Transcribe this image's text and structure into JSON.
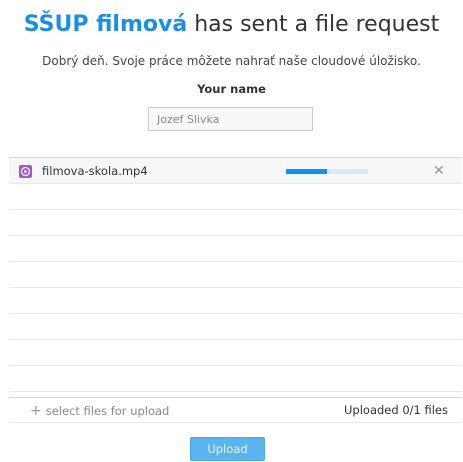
{
  "header": {
    "sender": "SŠUP filmová",
    "rest": "has sent a file request"
  },
  "message": "Dobrý deň. Svoje práce môžete nahrať naše cloudové úložisko.",
  "name_field": {
    "label": "Your name",
    "value": "Jozef Slivka"
  },
  "files": [
    {
      "name": "filmova-skola.mp4",
      "icon": "video-file-icon",
      "progress_fraction": 0.5,
      "remove_glyph": "✕"
    }
  ],
  "footer": {
    "plus_glyph": "+",
    "select_label": "select files for upload",
    "status": "Uploaded 0/1 files"
  },
  "upload_button": {
    "label": "Upload"
  },
  "colors": {
    "accent": "#1a8fe3",
    "file_icon": "#9b59d0",
    "button": "#5ab4ef"
  }
}
